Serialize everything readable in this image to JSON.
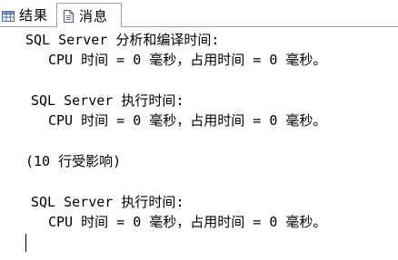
{
  "tabs": [
    {
      "label": "结果",
      "icon": "grid-icon"
    },
    {
      "label": "消息",
      "icon": "document-icon"
    }
  ],
  "messages": {
    "parse_title": "SQL Server 分析和编译时间:",
    "parse_cpu": "CPU 时间 = 0 毫秒，占用时间 = 0 毫秒。",
    "exec1_title": "SQL Server 执行时间:",
    "exec1_cpu": "CPU 时间 = 0 毫秒，占用时间 = 0 毫秒。",
    "rows_affected": "(10 行受影响)",
    "exec2_title": "SQL Server 执行时间:",
    "exec2_cpu": "CPU 时间 = 0 毫秒，占用时间 = 0 毫秒。"
  }
}
